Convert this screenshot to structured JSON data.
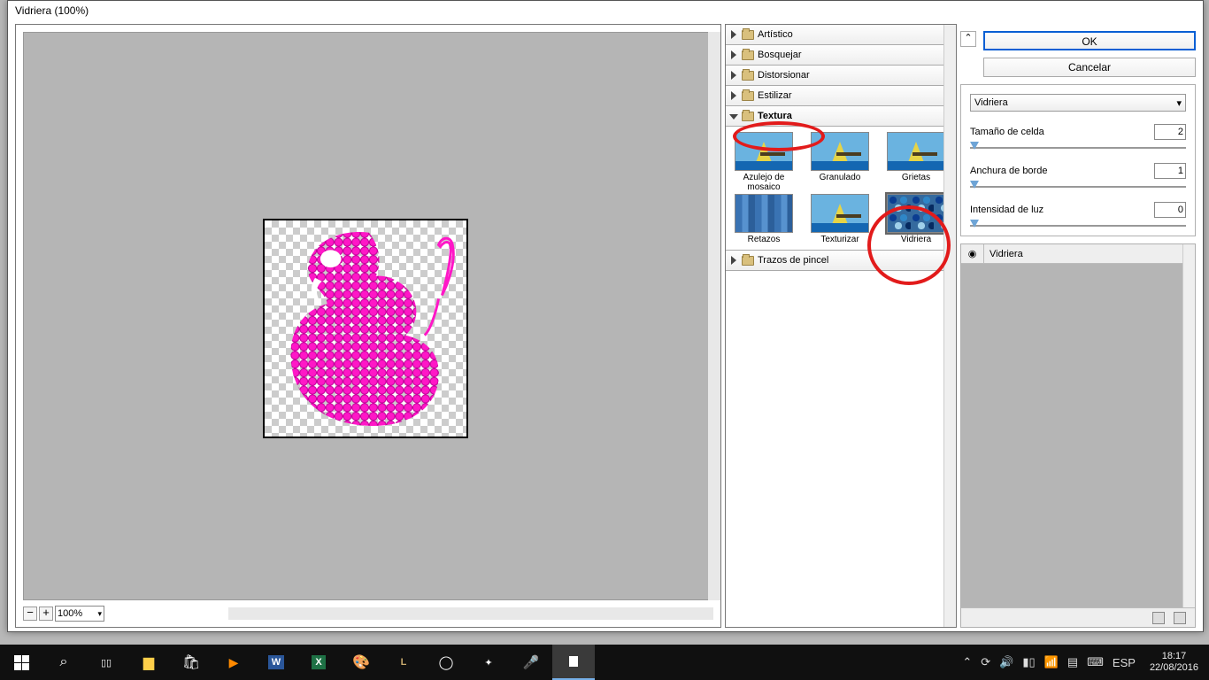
{
  "dialog": {
    "title": "Vidriera (100%)"
  },
  "zoom": {
    "minus": "−",
    "plus": "+",
    "value": "100%"
  },
  "categories": [
    {
      "label": "Artístico",
      "open": false
    },
    {
      "label": "Bosquejar",
      "open": false
    },
    {
      "label": "Distorsionar",
      "open": false
    },
    {
      "label": "Estilizar",
      "open": false
    },
    {
      "label": "Textura",
      "open": true
    },
    {
      "label": "Trazos de pincel",
      "open": false
    }
  ],
  "thumbs": [
    {
      "label": "Azulejo de mosaico"
    },
    {
      "label": "Granulado"
    },
    {
      "label": "Grietas"
    },
    {
      "label": "Retazos"
    },
    {
      "label": "Texturizar"
    },
    {
      "label": "Vidriera"
    }
  ],
  "buttons": {
    "ok": "OK",
    "cancel": "Cancelar"
  },
  "filter_combo": "Vidriera",
  "settings": [
    {
      "name": "Tamaño de celda",
      "value": "2"
    },
    {
      "name": "Anchura de borde",
      "value": "1"
    },
    {
      "name": "Intensidad de luz",
      "value": "0"
    }
  ],
  "layers": {
    "entry": "Vidriera"
  },
  "tray": {
    "lang": "ESP",
    "time": "18:17",
    "date": "22/08/2016",
    "chev": "⌃"
  }
}
